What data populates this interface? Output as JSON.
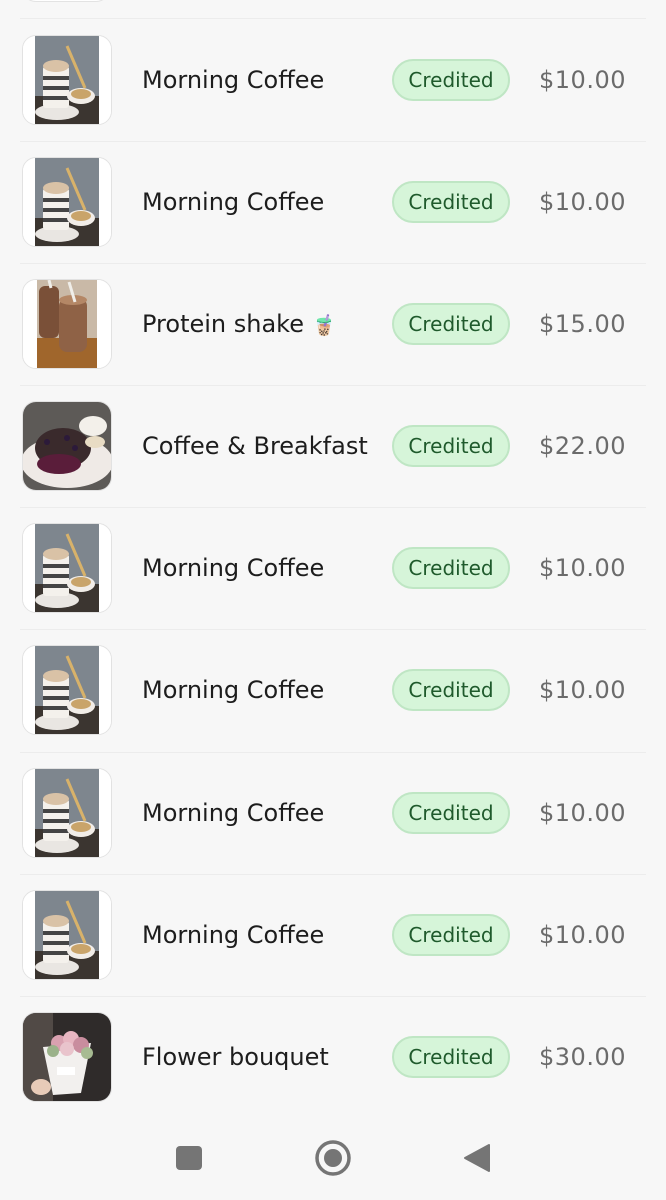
{
  "transactions": [
    {
      "title": "Morning Coffee",
      "status": "Credited",
      "amount": "$10.00",
      "image": "coffee-cup-photo"
    },
    {
      "title": "Morning Coffee",
      "status": "Credited",
      "amount": "$10.00",
      "image": "coffee-cup-photo"
    },
    {
      "title": "Protein shake",
      "emoji": "🧋",
      "status": "Credited",
      "amount": "$15.00",
      "image": "protein-shake-photo"
    },
    {
      "title": "Coffee & Breakfast",
      "status": "Credited",
      "amount": "$22.00",
      "image": "breakfast-cake-photo"
    },
    {
      "title": "Morning Coffee",
      "status": "Credited",
      "amount": "$10.00",
      "image": "coffee-cup-photo"
    },
    {
      "title": "Morning Coffee",
      "status": "Credited",
      "amount": "$10.00",
      "image": "coffee-cup-photo"
    },
    {
      "title": "Morning Coffee",
      "status": "Credited",
      "amount": "$10.00",
      "image": "coffee-cup-photo"
    },
    {
      "title": "Morning Coffee",
      "status": "Credited",
      "amount": "$10.00",
      "image": "coffee-cup-photo"
    },
    {
      "title": "Flower bouquet",
      "status": "Credited",
      "amount": "$30.00",
      "image": "flower-bouquet-photo"
    }
  ],
  "nav": {
    "recents": "square-icon",
    "home": "circle-home-icon",
    "back": "triangle-back-icon"
  },
  "colors": {
    "badge_bg": "#d6f5d9",
    "badge_border": "#bfe6c4",
    "badge_text": "#1f5a2c",
    "amount_text": "#6b6b6b",
    "title_text": "#1d1d1d",
    "background": "#f7f7f7"
  }
}
